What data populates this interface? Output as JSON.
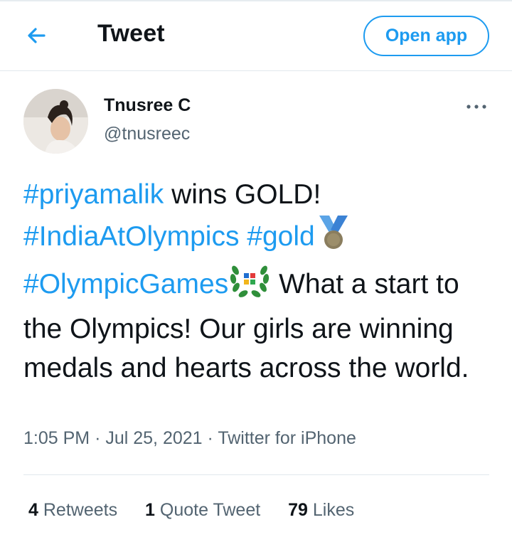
{
  "header": {
    "title": "Tweet",
    "open_app_label": "Open app",
    "back_icon": "arrow-left-icon"
  },
  "author": {
    "display_name": "Tnusree C",
    "handle": "@tnusreec"
  },
  "tweet": {
    "tag_priyamalik": "#priyamalik",
    "text_1": " wins GOLD!",
    "tag_india": "#IndiaAtOlympics",
    "tag_gold": "#gold",
    "tag_games": "#OlympicGames",
    "text_2": " What a start to the Olympics! Our girls are winning medals and hearts across the world."
  },
  "meta": {
    "time": "1:05 PM",
    "date": "Jul 25, 2021",
    "source": "Twitter for iPhone",
    "separator": "·"
  },
  "stats": {
    "retweets_count": "4",
    "retweets_label": "Retweets",
    "quotes_count": "1",
    "quotes_label": "Quote Tweet",
    "likes_count": "79",
    "likes_label": "Likes"
  },
  "colors": {
    "accent": "#1d9bf0",
    "secondary_text": "#536471",
    "divider": "#e1e8ed"
  }
}
